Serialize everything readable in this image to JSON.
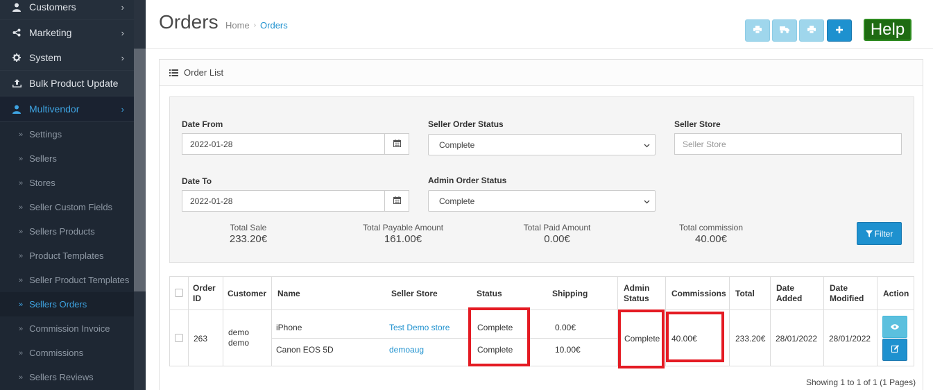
{
  "sidebar": {
    "menu": [
      {
        "label": "Customers",
        "icon": "user-icon"
      },
      {
        "label": "Marketing",
        "icon": "share-icon"
      },
      {
        "label": "System",
        "icon": "gear-icon"
      },
      {
        "label": "Bulk Product Update",
        "icon": "upload-icon"
      },
      {
        "label": "Multivendor",
        "icon": "user-icon"
      }
    ],
    "submenu": [
      "Settings",
      "Sellers",
      "Stores",
      "Seller Custom Fields",
      "Sellers Products",
      "Product Templates",
      "Seller Product Templates",
      "Sellers Orders",
      "Commission Invoice",
      "Commissions",
      "Sellers Reviews"
    ]
  },
  "header": {
    "title": "Orders",
    "breadcrumb": {
      "home": "Home",
      "current": "Orders"
    },
    "help_label": "Help"
  },
  "panel": {
    "heading": "Order List"
  },
  "filter": {
    "date_from_label": "Date From",
    "date_from_value": "2022-01-28",
    "date_to_label": "Date To",
    "date_to_value": "2022-01-28",
    "seller_order_status_label": "Seller Order Status",
    "seller_order_status_value": "Complete",
    "admin_order_status_label": "Admin Order Status",
    "admin_order_status_value": "Complete",
    "seller_store_label": "Seller Store",
    "seller_store_placeholder": "Seller Store",
    "filter_button": "Filter"
  },
  "totals": [
    {
      "label": "Total Sale",
      "value": "233.20€"
    },
    {
      "label": "Total Payable Amount",
      "value": "161.00€"
    },
    {
      "label": "Total Paid Amount",
      "value": "0.00€"
    },
    {
      "label": "Total commission",
      "value": "40.00€"
    }
  ],
  "table": {
    "headers": {
      "order_id_1": "Order",
      "order_id_2": "ID",
      "customer": "Customer",
      "name": "Name",
      "seller_store": "Seller Store",
      "status": "Status",
      "shipping": "Shipping",
      "admin_status_1": "Admin",
      "admin_status_2": "Status",
      "commissions": "Commissions",
      "total": "Total",
      "date_added_1": "Date",
      "date_added_2": "Added",
      "date_modified_1": "Date",
      "date_modified_2": "Modified",
      "action": "Action"
    },
    "order": {
      "order_id": "263",
      "customer_1": "demo",
      "customer_2": "demo",
      "admin_status": "Complete",
      "commission": "40.00€",
      "total": "233.20€",
      "date_added": "28/01/2022",
      "date_modified": "28/01/2022",
      "products": [
        {
          "name": "iPhone",
          "store": "Test Demo store",
          "status": "Complete",
          "shipping": "0.00€"
        },
        {
          "name": "Canon EOS 5D",
          "store": "demoaug",
          "status": "Complete",
          "shipping": "10.00€"
        }
      ]
    }
  },
  "pagination": "Showing 1 to 1 of 1 (1 Pages)",
  "colors": {
    "sidebar_bg": "#1e2733",
    "accent": "#1e91cf",
    "help_green": "#1e6b12",
    "highlight_red": "#e41b23"
  }
}
